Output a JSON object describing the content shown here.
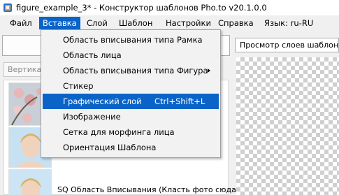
{
  "window": {
    "title": "figure_example_3* - Конструктор шаблонов Pho.to v20.1.0.0"
  },
  "menubar": {
    "items": [
      {
        "label": "Файл"
      },
      {
        "label": "Вставка"
      },
      {
        "label": "Слой"
      },
      {
        "label": "Шаблон"
      },
      {
        "label": "Настройки"
      },
      {
        "label": "Справка"
      },
      {
        "label": "Язык: ru-RU"
      }
    ],
    "active": "Вставка"
  },
  "dropdown": {
    "items": [
      {
        "label": "Область вписывания типа Рамка"
      },
      {
        "label": "Область лица"
      },
      {
        "label": "Область вписывания типа Фигура",
        "submenu": true
      },
      {
        "label": "Стикер"
      },
      {
        "label": "Графический слой",
        "shortcut": "Ctrl+Shift+L",
        "highlighted": true
      },
      {
        "label": "Изображение"
      },
      {
        "label": "Сетка для морфинга лица"
      },
      {
        "label": "Ориентация Шаблона"
      }
    ]
  },
  "left_panel": {
    "search_placeholder": "Вертика",
    "list_items": [
      {
        "label": ""
      },
      {
        "label": ""
      },
      {
        "label": "SQ Область Вписывания (Класть фото сюда)"
      }
    ]
  },
  "right_panel": {
    "tab_label": "Просмотр слоев шаблона и"
  },
  "colors": {
    "menu_highlight": "#0a64c8",
    "checker": "#cfcfcf"
  }
}
